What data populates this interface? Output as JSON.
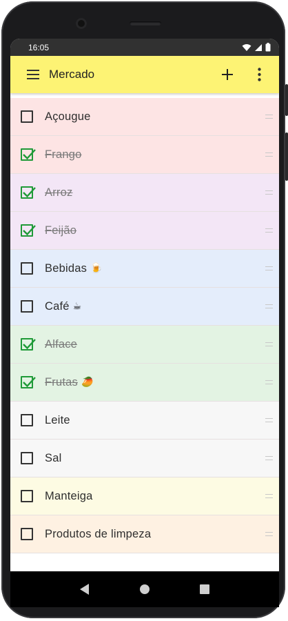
{
  "status_bar": {
    "time": "16:05"
  },
  "toolbar": {
    "title": "Mercado"
  },
  "items": [
    {
      "label": "Açougue",
      "checked": false,
      "color": "#fde4e4",
      "emoji": ""
    },
    {
      "label": "Frango",
      "checked": true,
      "color": "#fde4e4",
      "emoji": ""
    },
    {
      "label": "Arroz",
      "checked": true,
      "color": "#f3e6f6",
      "emoji": ""
    },
    {
      "label": "Feijão",
      "checked": true,
      "color": "#f3e6f6",
      "emoji": ""
    },
    {
      "label": "Bebidas",
      "checked": false,
      "color": "#e4edfb",
      "emoji": "🍺"
    },
    {
      "label": "Café",
      "checked": false,
      "color": "#e4edfb",
      "emoji": "☕"
    },
    {
      "label": "Alface",
      "checked": true,
      "color": "#e3f3e3",
      "emoji": ""
    },
    {
      "label": "Frutas",
      "checked": true,
      "color": "#e3f3e3",
      "emoji": "🥭"
    },
    {
      "label": "Leite",
      "checked": false,
      "color": "#f7f7f7",
      "emoji": ""
    },
    {
      "label": "Sal",
      "checked": false,
      "color": "#f7f7f7",
      "emoji": ""
    },
    {
      "label": "Manteiga",
      "checked": false,
      "color": "#fdfbe3",
      "emoji": ""
    },
    {
      "label": "Produtos de limpeza",
      "checked": false,
      "color": "#fef1e2",
      "emoji": ""
    }
  ],
  "icons": {
    "menu": "hamburger-icon",
    "add": "plus-icon",
    "more": "more-vertical-icon",
    "back": "back-triangle-icon",
    "home": "home-circle-icon",
    "recents": "recents-square-icon"
  },
  "colors": {
    "toolbar": "#fdf374",
    "check": "#1f9a38",
    "status_bar": "#313131"
  }
}
